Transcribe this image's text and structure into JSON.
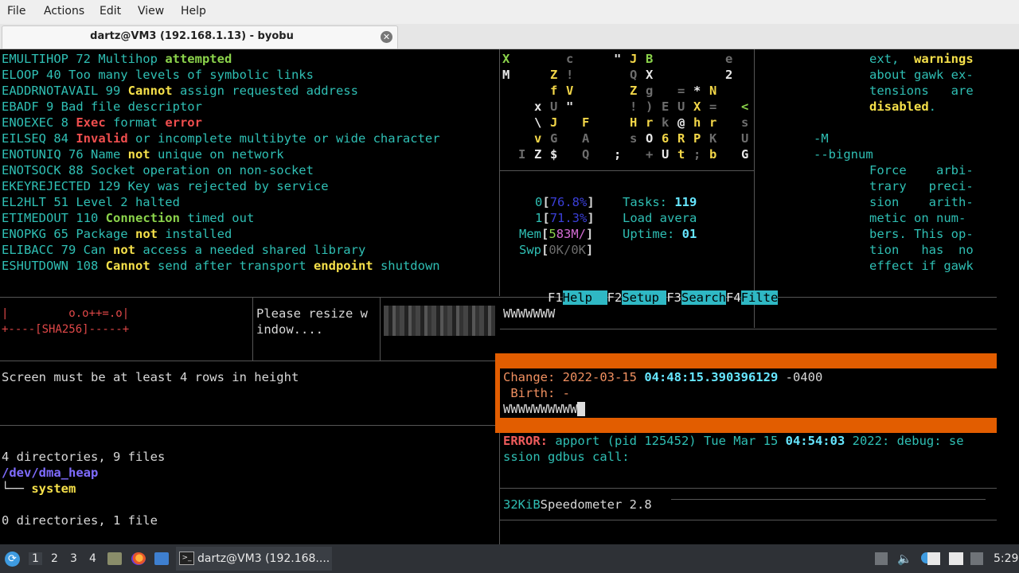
{
  "menubar": {
    "items": [
      "File",
      "Actions",
      "Edit",
      "View",
      "Help"
    ]
  },
  "tab": {
    "title": "dartz@VM3 (192.168.1.13) - byobu"
  },
  "errno_lines": {
    "l1": {
      "a": "EMULTIHOP 72 Multihop ",
      "b": "attempted"
    },
    "l2": {
      "a": "ELOOP 40 Too many levels of symbolic links"
    },
    "l3": {
      "a": "EADDRNOTAVAIL 99 ",
      "b": "Cannot",
      "c": " assign requested address"
    },
    "l4": {
      "a": "EBADF 9 Bad file descriptor"
    },
    "l5": {
      "a": "ENOEXEC 8 ",
      "b": "Exec",
      "c": " format ",
      "d": "error"
    },
    "l6": {
      "a": "EILSEQ 84 ",
      "b": "Invalid",
      "c": " or incomplete multibyte or wide character"
    },
    "l7": {
      "a": "ENOTUNIQ 76 Name ",
      "b": "not",
      "c": " unique on network"
    },
    "l8": {
      "a": "ENOTSOCK 88 Socket operation on non-socket"
    },
    "l9": {
      "a": "EKEYREJECTED 129 Key was rejected by service"
    },
    "l10": {
      "a": "EL2HLT 51 Level 2 halted"
    },
    "l11": {
      "a": "ETIMEDOUT 110 ",
      "b": "Connection",
      "c": " timed out"
    },
    "l12": {
      "a": "ENOPKG 65 Package ",
      "b": "not",
      "c": " installed"
    },
    "l13": {
      "a": "ELIBACC 79 Can ",
      "b": "not",
      "c": " access a needed shared library"
    },
    "l14": {
      "a": "ESHUTDOWN 108 ",
      "b": "Cannot",
      "c": " send after transport ",
      "d": "endpoint",
      "e": " shutdown"
    }
  },
  "matrix": {
    "r1": [
      "X",
      "c",
      "\"",
      "J",
      "B",
      "e"
    ],
    "r2": [
      "M",
      "Z",
      "!",
      "Q",
      "X",
      "2"
    ],
    "r3": [
      "f",
      "V",
      "Z",
      "g",
      "=",
      "*",
      "N"
    ],
    "r4": [
      "x",
      "U",
      "\"",
      "!",
      ")",
      "E",
      "U",
      "X",
      "=",
      "<"
    ],
    "r5": [
      "\\",
      "J",
      "F",
      "H",
      "r",
      "k",
      "@",
      "h",
      "r",
      "s"
    ],
    "r6": [
      "v",
      "G",
      "A",
      "s",
      "O",
      "6",
      "R",
      "P",
      "K",
      "U"
    ],
    "r7": [
      "I",
      "Z",
      "$",
      "Q",
      ";",
      "+",
      "U",
      "t",
      ";",
      "b",
      "G"
    ]
  },
  "htop": {
    "cpu0_label": "0",
    "cpu0_value": "76.8%",
    "cpu1_label": "1",
    "cpu1_value": "71.3%",
    "mem_label": "Mem",
    "mem_a": "5",
    "mem_b": "83M/",
    "swp_label": "Swp",
    "swp_value": "0K/0K",
    "tasks_label": "Tasks: ",
    "tasks_value": "119",
    "load_label": "Load avera",
    "uptime_label": "Uptime: ",
    "uptime_value": "01",
    "fkeys": [
      {
        "key": "F1",
        "label": "Help  "
      },
      {
        "key": "F2",
        "label": "Setup "
      },
      {
        "key": "F3",
        "label": "Search"
      },
      {
        "key": "F4",
        "label": "Filte"
      }
    ]
  },
  "manpage": {
    "l1a": "ext,  ",
    "l1b": "warnings",
    "l2": "about gawk ex-",
    "l3": "tensions   are",
    "l4": "disabled",
    "l4b": ".",
    "opt1": "-M",
    "opt2": "--bignum",
    "l7": "Force    arbi-",
    "l8": "trary   preci-",
    "l9": "sion    arith-",
    "l10": "metic on num-",
    "l11": "bers. This op-",
    "l12": "tion   has  no",
    "l13": "effect if gawk"
  },
  "randomart": {
    "line1": "|         o.o++=.o|",
    "line2": "+----[SHA256]-----+"
  },
  "resize_msg": {
    "line1": "Please resize w",
    "line2": "indow...."
  },
  "wpane": {
    "text": "WWWWWWW"
  },
  "screen_msg": "Screen must be at least 4 rows in height",
  "stat": {
    "change_label": "Change: ",
    "change_date": "2022-03-15 ",
    "change_time": "04:48:15.390396129",
    "change_tz": " -0400",
    "birth": " Birth: -",
    "wline": "WWWWWWWWWW"
  },
  "tree1": {
    "summary": "4 directories, 9 files",
    "path": "/dev/dma_heap",
    "branch": "└── ",
    "child": "system"
  },
  "tree2": {
    "summary": "0 directories, 1 file"
  },
  "logline": {
    "err": "ERROR:",
    "a": " apport (pid 125452) Tue Mar 15 ",
    "time": "04:54:03",
    "b": " 2022: debug: se",
    "l2": "ssion gdbus call:"
  },
  "speedo": {
    "size": "32KiB",
    "name": "Speedometer 2.8"
  },
  "taskbar": {
    "workspaces": [
      "1",
      "2",
      "3",
      "4"
    ],
    "task_label": "dartz@VM3 (192.168....",
    "clock": "5:29",
    "accent": "#3e9be0"
  }
}
